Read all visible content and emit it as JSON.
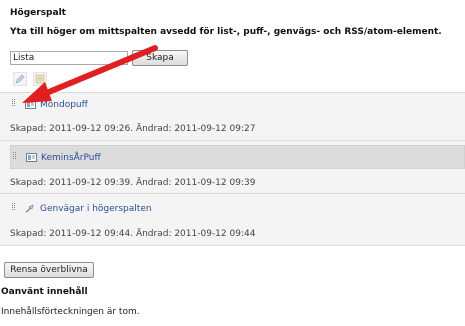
{
  "column": {
    "title": "Högerspalt",
    "description": "Yta till höger om mittspalten avsedd för list-, puff-, genvägs- och RSS/atom-element."
  },
  "create": {
    "selected_type": "Lista",
    "button_label": "Skapa"
  },
  "tools": [
    {
      "icon": "edit-icon"
    },
    {
      "icon": "properties-icon"
    }
  ],
  "items": [
    {
      "icon": "puff-icon",
      "title": "Mondopuff",
      "meta": "Skapad: 2011-09-12 09:26. Ändrad: 2011-09-12 09:27"
    },
    {
      "icon": "puff-icon",
      "title": "KeminsÅrPuff",
      "meta": "Skapad: 2011-09-12 09:39. Ändrad: 2011-09-12 09:39"
    },
    {
      "icon": "shortcut-icon",
      "title": "Genvägar i högerspalten",
      "meta": "Skapad: 2011-09-12 09:44. Ändrad: 2011-09-12 09:44"
    }
  ],
  "clear_button": "Rensa överblivna",
  "unused": {
    "title": "Oanvänt innehåll",
    "empty_text": "Innehållsförteckningen är tom."
  },
  "colors": {
    "link": "#2b4d96",
    "annotation_arrow": "#e02020"
  }
}
